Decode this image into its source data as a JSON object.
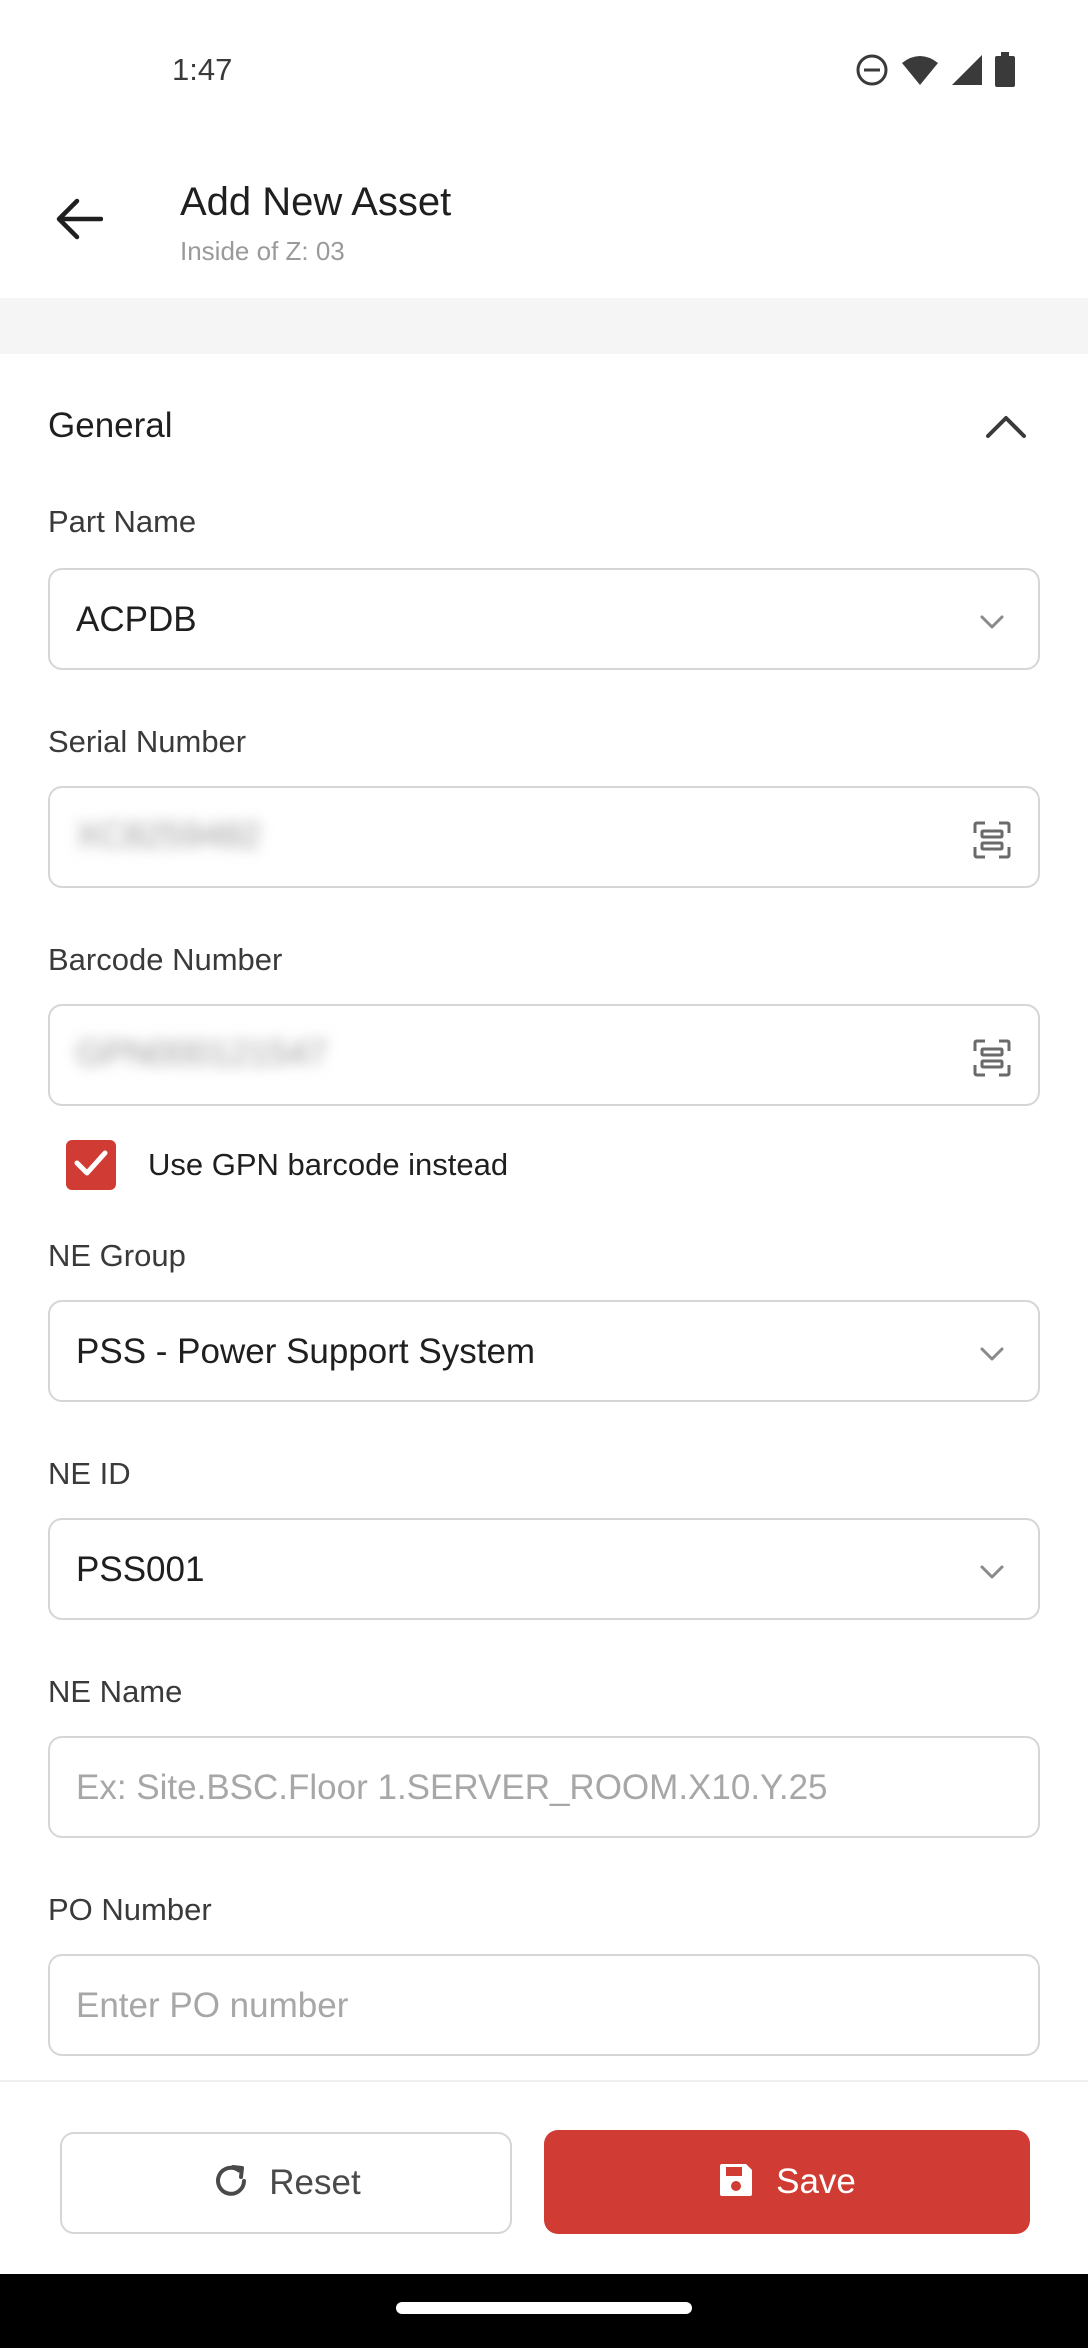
{
  "status_bar": {
    "time": "1:47"
  },
  "header": {
    "title": "Add New Asset",
    "subtitle": "Inside of Z: 03"
  },
  "section": {
    "title": "General"
  },
  "fields": {
    "part_name": {
      "label": "Part Name",
      "value": "ACPDB"
    },
    "serial_number": {
      "label": "Serial Number",
      "value": "XC8259482"
    },
    "barcode_number": {
      "label": "Barcode Number",
      "value": "GPN000121547"
    },
    "use_gpn": {
      "label": "Use GPN barcode instead",
      "checked": true
    },
    "ne_group": {
      "label": "NE Group",
      "value": "PSS - Power Support System"
    },
    "ne_id": {
      "label": "NE ID",
      "value": "PSS001"
    },
    "ne_name": {
      "label": "NE Name",
      "placeholder": "Ex: Site.BSC.Floor 1.SERVER_ROOM.X10.Y.25"
    },
    "po_number": {
      "label": "PO Number",
      "placeholder": "Enter PO number"
    }
  },
  "actions": {
    "reset_label": "Reset",
    "save_label": "Save"
  },
  "colors": {
    "accent": "#d03b33",
    "border": "#d6d6d6",
    "placeholder": "#a7a7a7"
  },
  "icons": [
    "minus-circle-icon",
    "wifi-icon",
    "signal-icon",
    "battery-icon",
    "back-arrow-icon",
    "chevron-up-icon",
    "chevron-down-icon",
    "scan-icon",
    "check-icon",
    "refresh-icon",
    "save-disk-icon"
  ]
}
